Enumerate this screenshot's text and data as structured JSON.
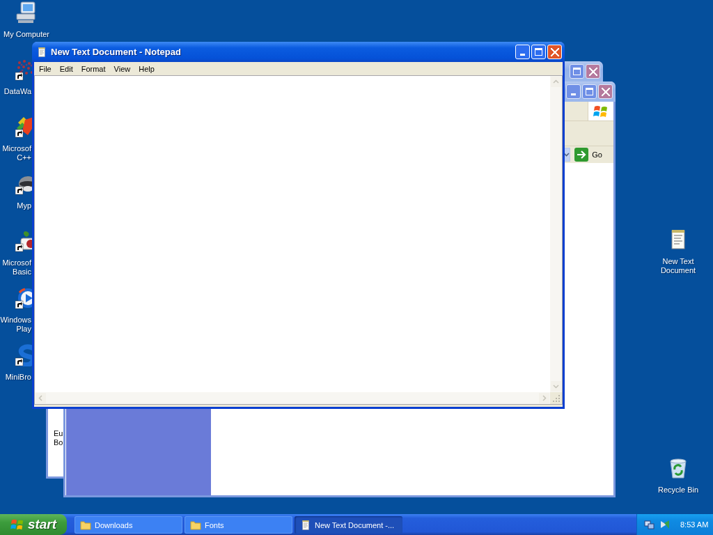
{
  "desktop_icons_left": [
    {
      "kind": "computer",
      "label_lines": [
        "My Computer"
      ],
      "shortcut": false
    },
    {
      "kind": "dots",
      "label_lines": [
        "DataWa"
      ],
      "shortcut": true
    },
    {
      "kind": "tiles",
      "label_lines": [
        "Microsof",
        "C++"
      ],
      "shortcut": true
    },
    {
      "kind": "animal",
      "label_lines": [
        "Myp"
      ],
      "shortcut": true
    },
    {
      "kind": "plant",
      "label_lines": [
        "Microsof",
        "Basic"
      ],
      "shortcut": true
    },
    {
      "kind": "media",
      "label_lines": [
        "Windows",
        "Play"
      ],
      "shortcut": true
    },
    {
      "kind": "swirl",
      "label_lines": [
        "MiniBro"
      ],
      "shortcut": true
    }
  ],
  "desktop_icons_right": [
    {
      "kind": "notepad",
      "label_lines": [
        "New Text",
        "Document"
      ],
      "shortcut": false
    },
    {
      "kind": "recycle",
      "label_lines": [
        "Recycle Bin"
      ],
      "shortcut": false
    }
  ],
  "background_windows": [
    {
      "kind": "side",
      "active": false,
      "side_text": [
        "Eu",
        "Bo"
      ]
    },
    {
      "kind": "browser",
      "active": false,
      "go_label": "Go"
    }
  ],
  "notepad": {
    "title": "New Text Document - Notepad",
    "active": true,
    "menu": [
      "File",
      "Edit",
      "Format",
      "View",
      "Help"
    ]
  },
  "taskbar": {
    "start_label": "start",
    "tasks": [
      {
        "kind": "folder",
        "label": "Downloads",
        "selected": false
      },
      {
        "kind": "folder",
        "label": "Fonts",
        "selected": false
      },
      {
        "kind": "notepad",
        "label": "New Text Document -...",
        "selected": true
      }
    ],
    "clock": "8:53 AM"
  }
}
